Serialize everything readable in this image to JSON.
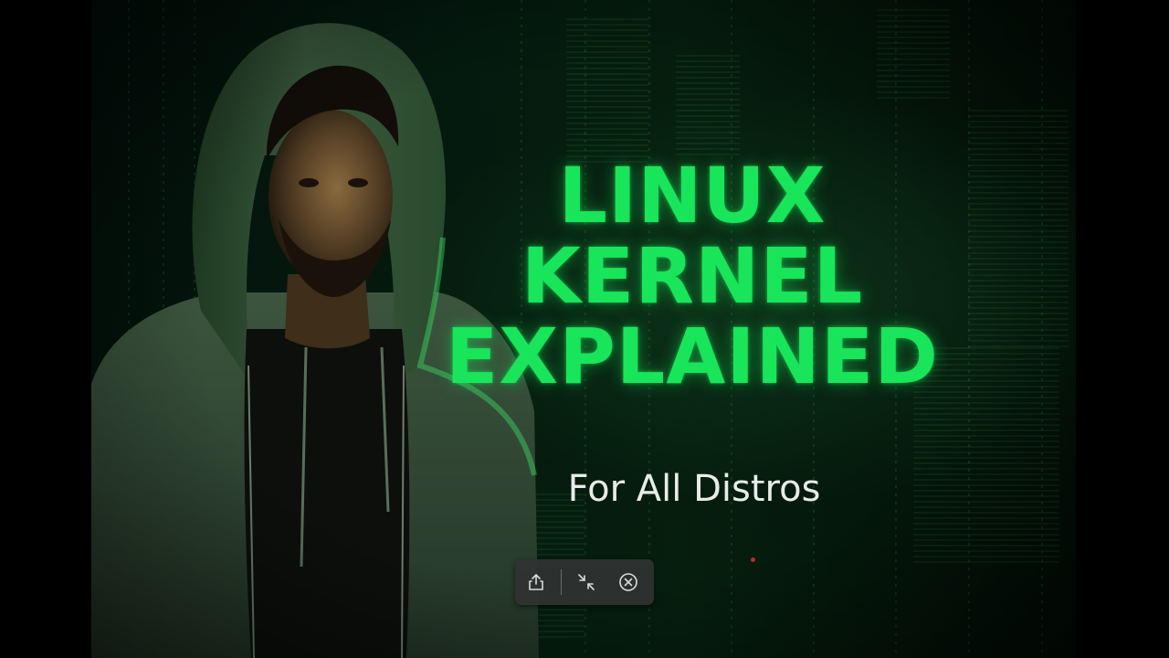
{
  "thumbnail": {
    "title_lines": [
      "LINUX",
      "KERNEL",
      "EXPLAINED"
    ],
    "subtitle": "For All Distros",
    "accent_color": "#19e55a",
    "subtitle_color": "#e8ece8"
  },
  "toolbar": {
    "share_icon": "share-icon",
    "minimize_icon": "minimize-icon",
    "close_icon": "close-icon"
  }
}
